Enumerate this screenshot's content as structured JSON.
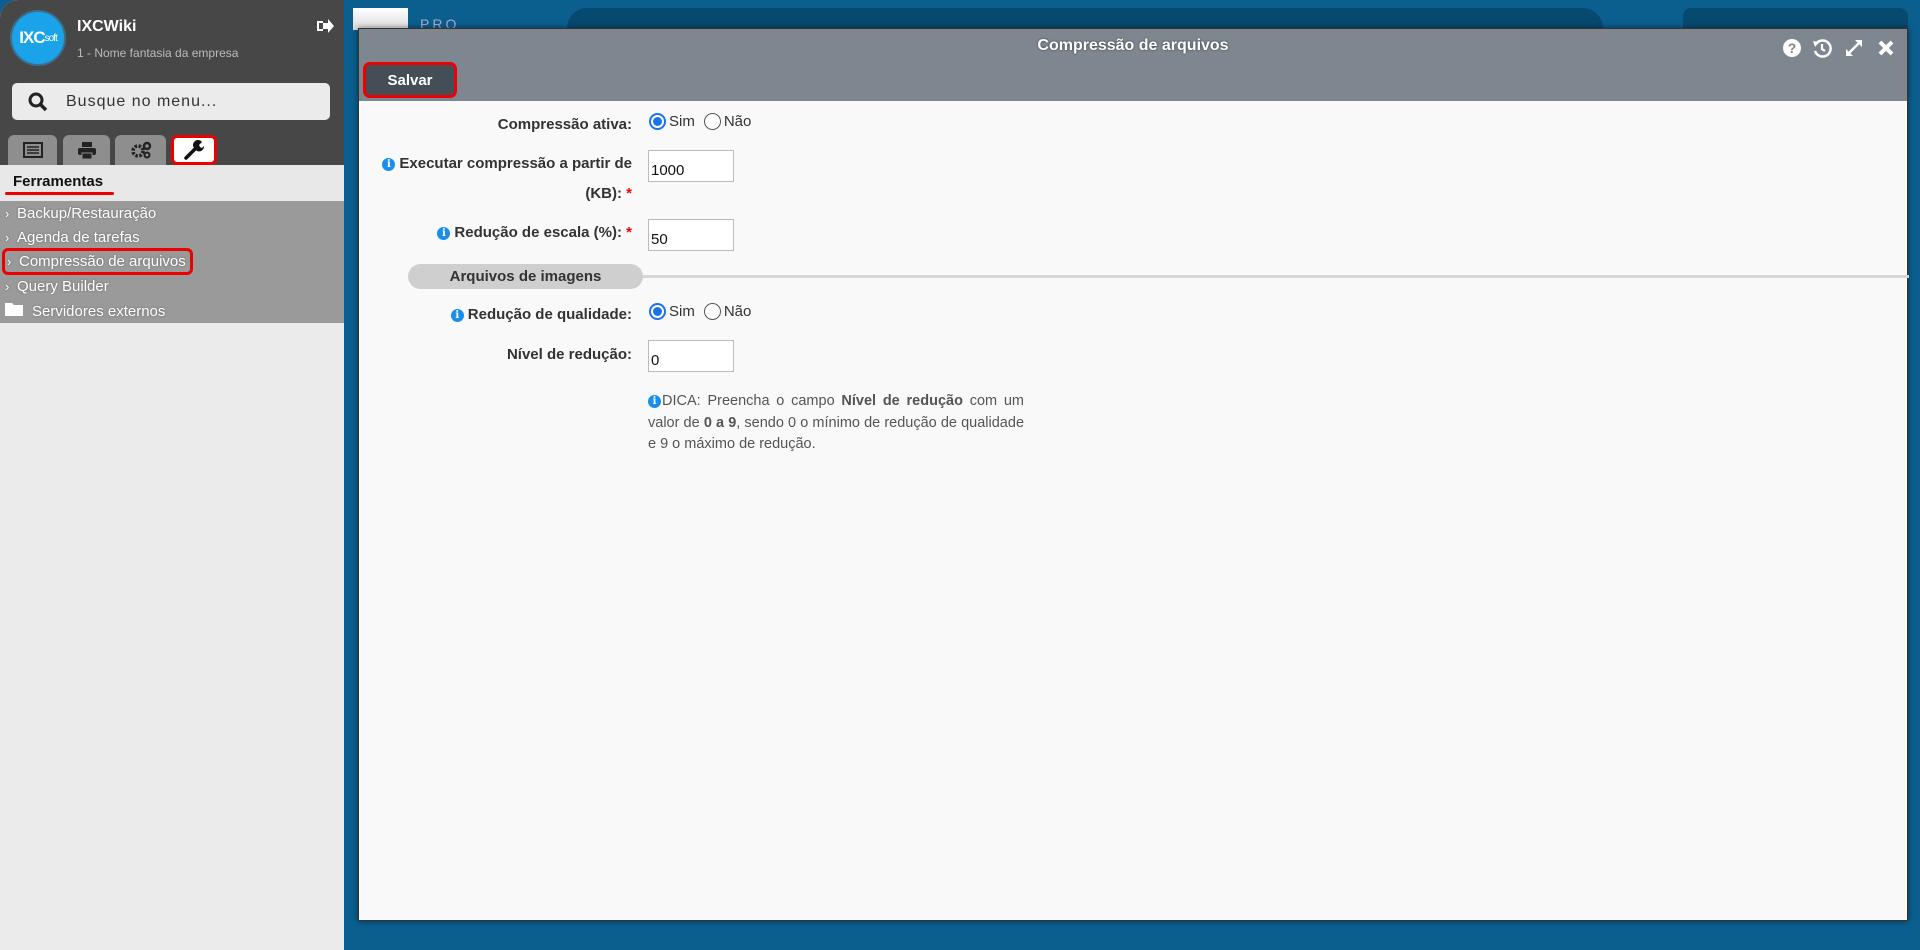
{
  "sidebar": {
    "app_title": "IXCWiki",
    "logo_text": "IXCsoft",
    "company": "1 - Nome fantasia da empresa",
    "search_placeholder": "Busque no menu...",
    "tabs": [
      {
        "icon": "list-icon"
      },
      {
        "icon": "printer-icon"
      },
      {
        "icon": "gears-icon"
      },
      {
        "icon": "wrench-icon",
        "active": true
      }
    ],
    "section_title": "Ferramentas",
    "items": [
      {
        "label": "Backup/Restauração",
        "icon": "chevron-right-icon"
      },
      {
        "label": "Agenda de tarefas",
        "icon": "chevron-right-icon"
      },
      {
        "label": "Compressão de arquivos",
        "icon": "chevron-right-icon",
        "selected": true
      },
      {
        "label": "Query Builder",
        "icon": "chevron-right-icon"
      },
      {
        "label": "Servidores externos",
        "icon": "folder-icon"
      }
    ]
  },
  "background": {
    "pro_text": "PRO"
  },
  "modal": {
    "title": "Compressão de arquivos",
    "save_label": "Salvar",
    "header_icons": [
      "help-icon",
      "history-icon",
      "expand-icon",
      "close-icon"
    ],
    "form": {
      "compressao_ativa": {
        "label": "Compressão ativa:",
        "options": [
          "Sim",
          "Não"
        ],
        "selected": "Sim"
      },
      "executar": {
        "label_line1": "Executar compressão a partir de",
        "label_line2": "(KB):",
        "required": "*",
        "value": "1000"
      },
      "escala": {
        "label": "Redução de escala (%):",
        "required": "*",
        "value": "50"
      },
      "section": "Arquivos de imagens",
      "qualidade": {
        "label": "Redução de qualidade:",
        "options": [
          "Sim",
          "Não"
        ],
        "selected": "Sim"
      },
      "nivel": {
        "label": "Nível de redução:",
        "value": "0"
      },
      "dica": {
        "p1": "DICA: Preencha o campo ",
        "b1": "Nível de redução",
        "p2": " com um valor de ",
        "b2": "0 a 9",
        "p3": ", sendo 0 o mínimo de redução de qualidade e 9 o máximo de redução."
      }
    }
  },
  "colors": {
    "accent": "#1a73e8",
    "highlight": "#ee0000",
    "header": "#7e8790",
    "background": "#0b5f8f"
  }
}
